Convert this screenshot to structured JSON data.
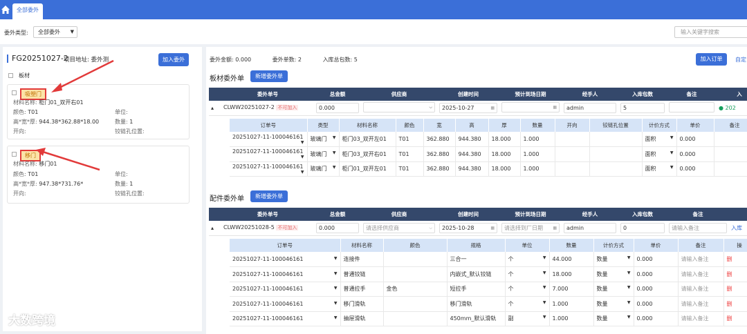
{
  "app": {
    "tab_label": "全部委外"
  },
  "filter": {
    "label": "委外类型:",
    "value": "全部委外",
    "search_placeholder": "输入关键字搜索"
  },
  "left": {
    "order_no": "FG20251027-2",
    "address": "项目地址: 委外测",
    "add_button": "加入委外",
    "sheet_label": "板材",
    "cards": [
      {
        "tag": "吸塑门",
        "material": "柜门01_双开右01",
        "color": "T01",
        "size": "944.38*362.88*18.00",
        "unit": "",
        "qty": "1",
        "open": "",
        "hinge": ""
      },
      {
        "tag": "移门",
        "material": "移门01",
        "color": "T01",
        "size": "947.38*731.76*",
        "unit": "",
        "qty": "1",
        "open": "",
        "hinge": ""
      }
    ],
    "card_labels": {
      "material": "材料名称:",
      "color": "颜色:",
      "size": "高*宽*厚:",
      "open": "开向:",
      "unit": "单位:",
      "qty": "数量:",
      "hinge": "铰链孔位置:"
    },
    "watermark": "大数跨境"
  },
  "right": {
    "stats": {
      "amount": "委外金额: 0.000",
      "count": "委外单数: 2",
      "packages": "入库总包数: 5"
    },
    "add_order_button": "加入订单",
    "custom_link": "自定",
    "sheet_section": {
      "title": "板材委外单",
      "new_button": "新增委外单",
      "headers": [
        "委外单号",
        "总金额",
        "供应商",
        "创建时间",
        "预计到场日期",
        "经手人",
        "入库包数",
        "备注",
        "入"
      ],
      "row": {
        "no": "CLWW20251027-2",
        "flag": "不可加入",
        "amount": "0.000",
        "supplier": "",
        "created": "2025-10-27",
        "eta": "",
        "handler": "admin",
        "packages": "5",
        "remark": "",
        "status": "202"
      },
      "sub_headers": [
        "订单号",
        "类型",
        "材料名称",
        "颜色",
        "宽",
        "高",
        "厚",
        "数量",
        "开向",
        "铰链孔位置",
        "计价方式",
        "单价",
        "备注"
      ],
      "sub_rows": [
        {
          "order": "20251027-11-100046161",
          "type": "玻璃门",
          "material": "柜门03_双开左01",
          "color": "T01",
          "w": "362.880",
          "h": "944.380",
          "t": "18.000",
          "qty": "1.000",
          "open": "",
          "hinge": "",
          "pricing": "面积",
          "price": "0.000",
          "remark": ""
        },
        {
          "order": "20251027-11-100046161",
          "type": "玻璃门",
          "material": "柜门03_双开右01",
          "color": "T01",
          "w": "362.880",
          "h": "944.380",
          "t": "18.000",
          "qty": "1.000",
          "open": "",
          "hinge": "",
          "pricing": "面积",
          "price": "0.000",
          "remark": ""
        },
        {
          "order": "20251027-11-100046161",
          "type": "玻璃门",
          "material": "柜门01_双开左01",
          "color": "T01",
          "w": "362.880",
          "h": "944.380",
          "t": "18.000",
          "qty": "1.000",
          "open": "",
          "hinge": "",
          "pricing": "面积",
          "price": "0.000",
          "remark": ""
        }
      ]
    },
    "parts_section": {
      "title": "配件委外单",
      "new_button": "新增委外单",
      "headers": [
        "委外单号",
        "总金额",
        "供应商",
        "创建时间",
        "预计到场日期",
        "经手人",
        "入库包数",
        "备注",
        ""
      ],
      "row": {
        "no": "CLWW20251028-5",
        "flag": "不可加入",
        "amount": "0.000",
        "supplier": "请选择供应商",
        "created": "2025-10-28",
        "eta": "请选择到厂日期",
        "handler": "admin",
        "packages": "0",
        "remark": "请输入备注",
        "action": "入库"
      },
      "sub_headers": [
        "订单号",
        "材料名称",
        "颜色",
        "规格",
        "单位",
        "数量",
        "计价方式",
        "单价",
        "备注",
        "操"
      ],
      "sub_rows": [
        {
          "order": "20251027-11-100046161",
          "material": "连接件",
          "color": "",
          "spec": "三合一",
          "unit": "个",
          "qty": "44.000",
          "pricing": "数量",
          "price": "0.000",
          "remark": "请输入备注",
          "op": "删"
        },
        {
          "order": "20251027-11-100046161",
          "material": "普通铰链",
          "color": "",
          "spec": "内嵌式_默认铰链",
          "unit": "个",
          "qty": "18.000",
          "pricing": "数量",
          "price": "0.000",
          "remark": "请输入备注",
          "op": "删"
        },
        {
          "order": "20251027-11-100046161",
          "material": "普通拉手",
          "color": "金色",
          "spec": "短拉手",
          "unit": "个",
          "qty": "7.000",
          "pricing": "数量",
          "price": "0.000",
          "remark": "请输入备注",
          "op": "删"
        },
        {
          "order": "20251027-11-100046161",
          "material": "移门滑轨",
          "color": "",
          "spec": "移门滑轨",
          "unit": "个",
          "qty": "1.000",
          "pricing": "数量",
          "price": "0.000",
          "remark": "请输入备注",
          "op": "删"
        },
        {
          "order": "20251027-11-100046161",
          "material": "抽屉滑轨",
          "color": "",
          "spec": "450mm_默认滑轨",
          "unit": "副",
          "qty": "1.000",
          "pricing": "数量",
          "price": "0.000",
          "remark": "请输入备注",
          "op": "删"
        }
      ]
    }
  },
  "colors": {
    "primary": "#3b6fd8",
    "header_dark": "#34486b",
    "sub_header": "#d6e4f7",
    "highlight": "#e23a3a"
  }
}
